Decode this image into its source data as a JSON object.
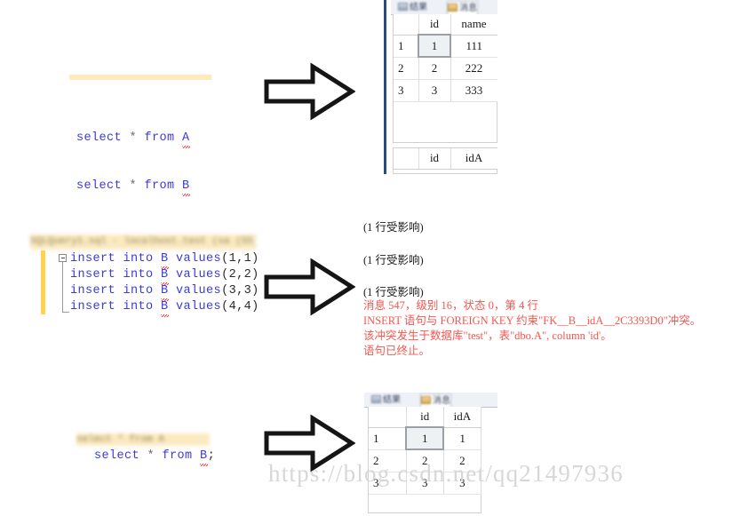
{
  "watermark": "https://blog.csdn.net/qq21497936",
  "sections": {
    "top": {
      "code": {
        "lines": [
          "select * from A",
          "select * from B"
        ]
      },
      "results": {
        "tabs": [
          {
            "label": "结果",
            "icon": "grid-icon",
            "active": false
          },
          {
            "label": "消息",
            "icon": "message-icon",
            "active": true
          }
        ],
        "grid_a": {
          "columns": [
            "",
            "id",
            "name"
          ],
          "rows": [
            [
              "1",
              "1",
              "111"
            ],
            [
              "2",
              "2",
              "222"
            ],
            [
              "3",
              "3",
              "333"
            ]
          ],
          "selected_cell": {
            "row": 0,
            "col": 1
          }
        },
        "grid_b": {
          "columns": [
            "",
            "id",
            "idA"
          ],
          "rows": []
        }
      }
    },
    "middle": {
      "code": {
        "blurred_header": "SQLQuery1.sql - localhost.test (sa (55))",
        "lines": [
          "insert into B values(1,1)",
          "insert into B values(2,2)",
          "insert into B values(3,3)",
          "insert into B values(4,4)"
        ]
      },
      "messages": [
        {
          "text": "(1 行受影响)",
          "color": "black"
        },
        {
          "text": "(1 行受影响)",
          "color": "black"
        },
        {
          "text": "(1 行受影响)",
          "color": "black"
        },
        {
          "text": "消息 547，级别 16，状态 0，第 4 行",
          "color": "red"
        },
        {
          "text": "INSERT 语句与 FOREIGN KEY 约束\"FK__B__idA__2C3393D0\"冲突。",
          "color": "red"
        },
        {
          "text": "该冲突发生于数据库\"test\"，表\"dbo.A\", column 'id'。",
          "color": "red"
        },
        {
          "text": "语句已终止。",
          "color": "red"
        }
      ]
    },
    "bottom": {
      "code": {
        "blurred_header": "select * from A",
        "lines": [
          "select * from B;"
        ]
      },
      "results": {
        "tabs": [
          {
            "label": "结果",
            "icon": "grid-icon",
            "active": false
          },
          {
            "label": "消息",
            "icon": "message-icon",
            "active": true
          }
        ],
        "grid": {
          "columns": [
            "",
            "id",
            "idA"
          ],
          "rows": [
            [
              "1",
              "1",
              "1"
            ],
            [
              "2",
              "2",
              "2"
            ],
            [
              "3",
              "3",
              "3"
            ]
          ],
          "selected_cell": {
            "row": 0,
            "col": 1
          }
        }
      }
    }
  },
  "colors": {
    "keyword": "#3b3bd8",
    "error_text": "#f4564f",
    "highlight_bar": "#fdebbf",
    "change_bar": "#ffd24d",
    "panel_edge": "#2b4a7d"
  }
}
